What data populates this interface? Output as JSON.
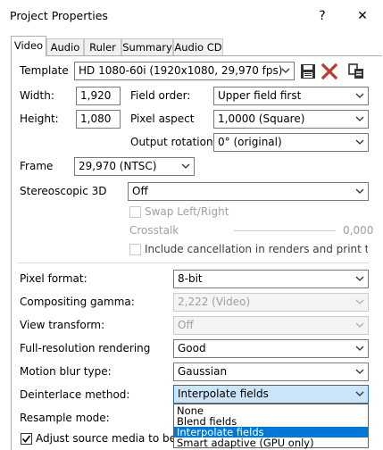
{
  "window": {
    "title": "Project Properties",
    "help_label": "?",
    "close_label": "✕"
  },
  "tabs": [
    {
      "label": "Video",
      "active": true
    },
    {
      "label": "Audio"
    },
    {
      "label": "Ruler"
    },
    {
      "label": "Summary"
    },
    {
      "label": "Audio CD"
    }
  ],
  "template": {
    "label": "Template",
    "value": "HD 1080-60i (1920x1080, 29,970 fps)"
  },
  "width": {
    "label": "Width:",
    "value": "1,920"
  },
  "height": {
    "label": "Height:",
    "value": "1,080"
  },
  "field_order": {
    "label": "Field order:",
    "value": "Upper field first"
  },
  "pixel_aspect": {
    "label": "Pixel aspect",
    "value": "1,0000 (Square)"
  },
  "output_rotation": {
    "label": "Output rotation:",
    "value": "0° (original)"
  },
  "frame": {
    "label": "Frame",
    "value": "29,970 (NTSC)"
  },
  "stereoscopic": {
    "label": "Stereoscopic 3D",
    "value": "Off"
  },
  "swap": {
    "label": "Swap Left/Right"
  },
  "crosstalk": {
    "label": "Crosstalk",
    "value": "0,000"
  },
  "cancellation": {
    "label": "Include cancellation in renders and print to ta"
  },
  "pixel_format": {
    "label": "Pixel format:",
    "value": "8-bit"
  },
  "compositing_gamma": {
    "label": "Compositing gamma:",
    "value": "2,222 (Video)"
  },
  "view_transform": {
    "label": "View transform:",
    "value": "Off"
  },
  "full_res": {
    "label": "Full-resolution rendering",
    "value": "Good"
  },
  "motion_blur": {
    "label": "Motion blur type:",
    "value": "Gaussian"
  },
  "deinterlace": {
    "label": "Deinterlace method:",
    "value": "Interpolate fields",
    "options": [
      "None",
      "Blend fields",
      "Interpolate fields",
      "Smart adaptive (GPU only)"
    ],
    "selected_index": 2
  },
  "resample": {
    "label": "Resample mode:"
  },
  "adjust_source": {
    "label": "Adjust source media to bett",
    "checked": true
  },
  "colors": {
    "accent": "#0078d7",
    "selection_bg": "#cce4f7",
    "disabled_text": "#a0a0a0"
  }
}
